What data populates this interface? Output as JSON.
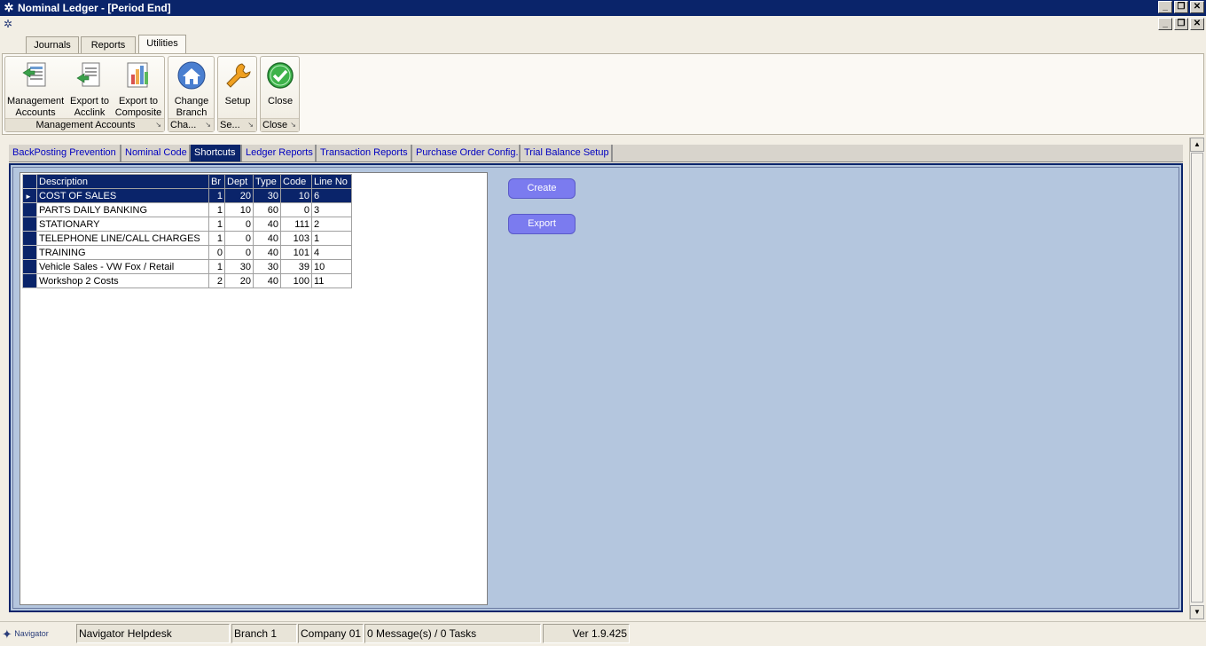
{
  "window": {
    "title": "Nominal Ledger - [Period End]"
  },
  "ribbon_tabs": [
    {
      "label": "Journals"
    },
    {
      "label": "Reports"
    },
    {
      "label": "Utilities"
    }
  ],
  "ribbon_groups": {
    "management_accounts": {
      "title": "Management Accounts",
      "buttons": {
        "management_accounts": {
          "line1": "Management",
          "line2": "Accounts"
        },
        "export_acclink": {
          "line1": "Export to",
          "line2": "Acclink"
        },
        "export_composite": {
          "line1": "Export to",
          "line2": "Composite"
        }
      }
    },
    "change_branch": {
      "title": "Cha...",
      "button": {
        "line1": "Change",
        "line2": "Branch"
      }
    },
    "setup": {
      "title": "Se...",
      "button": {
        "line1": "Setup"
      }
    },
    "close": {
      "title": "Close",
      "button": {
        "line1": "Close"
      }
    }
  },
  "inner_tabs": [
    {
      "label": "BackPosting Prevention"
    },
    {
      "label": "Nominal Code"
    },
    {
      "label": "Shortcuts"
    },
    {
      "label": "Ledger Reports"
    },
    {
      "label": "Transaction Reports"
    },
    {
      "label": "Purchase Order Config."
    },
    {
      "label": "Trial Balance Setup"
    }
  ],
  "grid": {
    "columns": [
      "Description",
      "Br",
      "Dept",
      "Type",
      "Code",
      "Line No"
    ],
    "rows": [
      {
        "description": "COST OF SALES",
        "br": "1",
        "dept": "20",
        "type": "30",
        "code": "10",
        "line_no": "6"
      },
      {
        "description": "PARTS DAILY BANKING",
        "br": "1",
        "dept": "10",
        "type": "60",
        "code": "0",
        "line_no": "3"
      },
      {
        "description": "STATIONARY",
        "br": "1",
        "dept": "0",
        "type": "40",
        "code": "111",
        "line_no": "2"
      },
      {
        "description": "TELEPHONE LINE/CALL CHARGES",
        "br": "1",
        "dept": "0",
        "type": "40",
        "code": "103",
        "line_no": "1"
      },
      {
        "description": "TRAINING",
        "br": "0",
        "dept": "0",
        "type": "40",
        "code": "101",
        "line_no": "4"
      },
      {
        "description": "Vehicle Sales - VW Fox / Retail",
        "br": "1",
        "dept": "30",
        "type": "30",
        "code": "39",
        "line_no": "10"
      },
      {
        "description": "Workshop 2 Costs",
        "br": "2",
        "dept": "20",
        "type": "40",
        "code": "100",
        "line_no": "11"
      }
    ]
  },
  "actions": {
    "create": "Create",
    "export": "Export"
  },
  "status": {
    "logo": "Navigator",
    "helpdesk": "Navigator Helpdesk",
    "branch": "Branch 1",
    "company": "Company 01",
    "messages": "0 Message(s) / 0 Tasks",
    "version": "Ver 1.9.425"
  },
  "colors": {
    "titlebar": "#0a246a",
    "panel": "#b4c6de",
    "button": "#7b7bef",
    "tab_text": "#0000c0"
  }
}
